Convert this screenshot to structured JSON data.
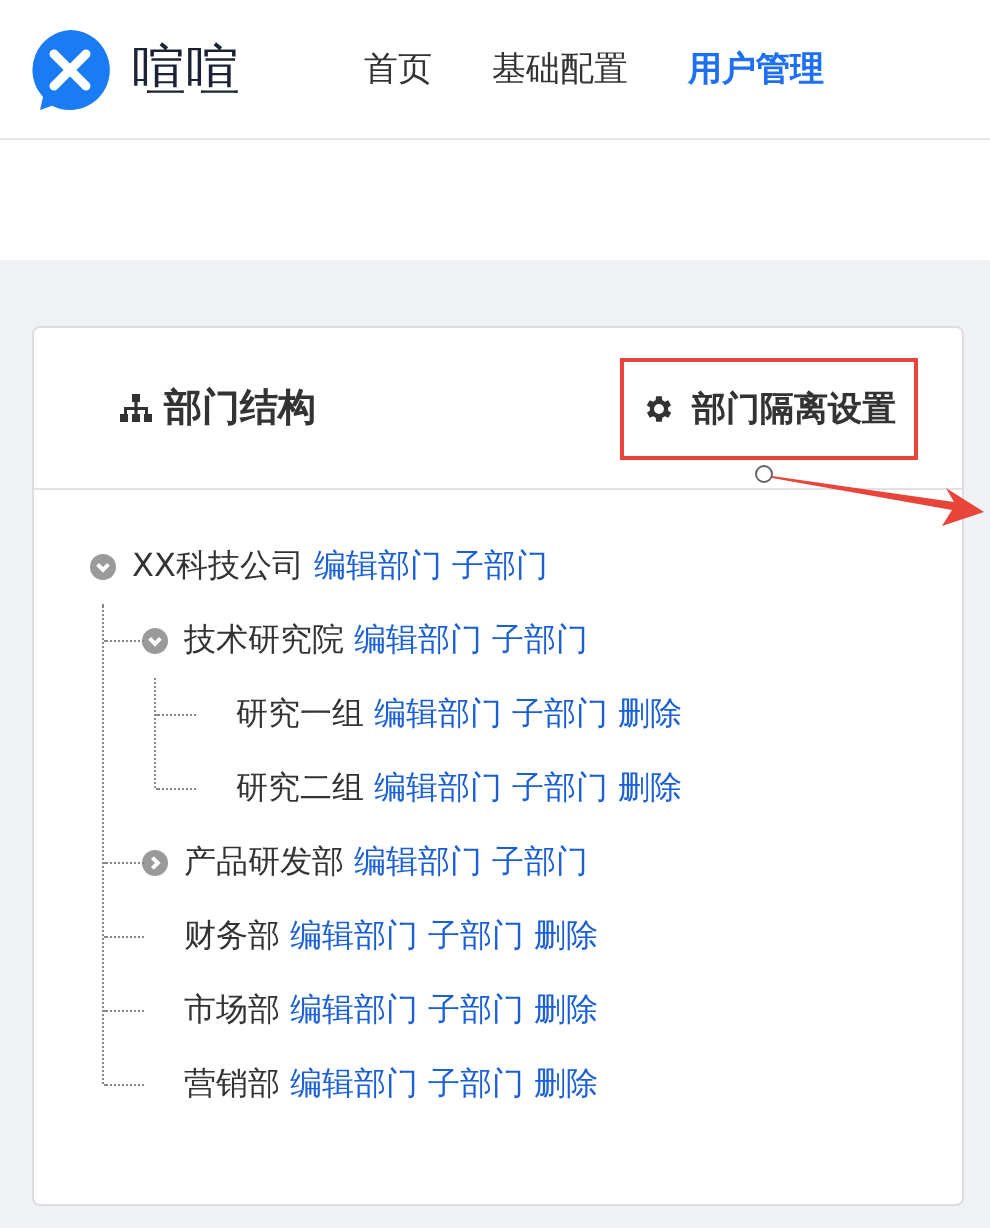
{
  "header": {
    "logo_text": "喧喧",
    "nav": [
      {
        "label": "首页",
        "selected": false
      },
      {
        "label": "基础配置",
        "selected": false
      },
      {
        "label": "用户管理",
        "selected": true
      }
    ]
  },
  "panel": {
    "title": "部门结构",
    "settings_button": {
      "label": "部门隔离设置",
      "highlighted": true
    },
    "tree": [
      {
        "name": "XX科技公司",
        "expanded": true,
        "actions": [
          "编辑部门",
          "子部门"
        ],
        "children": [
          {
            "name": "技术研究院",
            "expanded": true,
            "actions": [
              "编辑部门",
              "子部门"
            ],
            "children": [
              {
                "name": "研究一组",
                "actions": [
                  "编辑部门",
                  "子部门",
                  "删除"
                ]
              },
              {
                "name": "研究二组",
                "actions": [
                  "编辑部门",
                  "子部门",
                  "删除"
                ]
              }
            ]
          },
          {
            "name": "产品研发部",
            "expanded": false,
            "actions": [
              "编辑部门",
              "子部门"
            ]
          },
          {
            "name": "财务部",
            "actions": [
              "编辑部门",
              "子部门",
              "删除"
            ]
          },
          {
            "name": "市场部",
            "actions": [
              "编辑部门",
              "子部门",
              "删除"
            ]
          },
          {
            "name": "营销部",
            "actions": [
              "编辑部门",
              "子部门",
              "删除"
            ]
          }
        ]
      }
    ]
  }
}
